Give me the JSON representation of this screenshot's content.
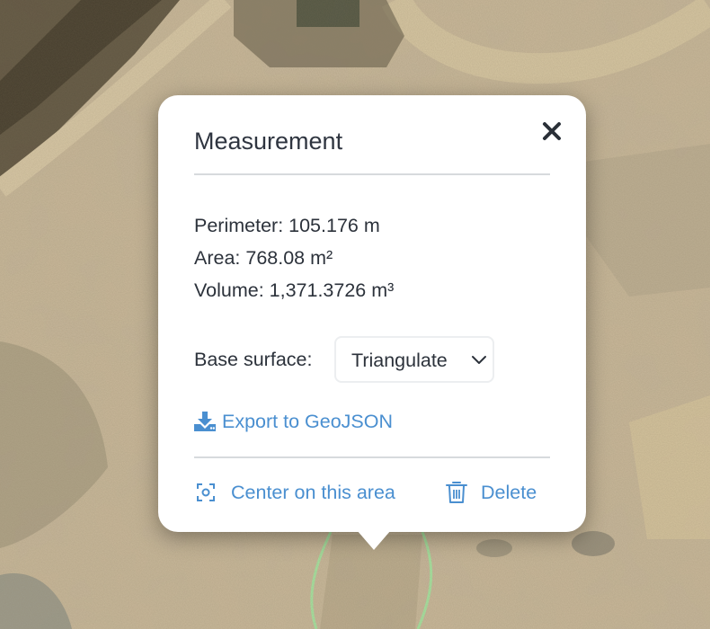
{
  "popup": {
    "title": "Measurement",
    "perimeter": "Perimeter: 105.176 m",
    "area": "Area: 768.08 m²",
    "volume": "Volume: 1,371.3726 m³",
    "base_surface_label": "Base surface:",
    "base_surface_value": "Triangulate",
    "export_label": "Export to GeoJSON",
    "center_label": "Center on this area",
    "delete_label": "Delete"
  },
  "icons": {
    "close": "close-icon",
    "export": "download-icon",
    "center": "focus-icon",
    "delete": "trash-icon",
    "select": "chevron-down-icon"
  },
  "colors": {
    "link": "#4a8fd0",
    "text": "#2c323b",
    "measurement_outline": "#a6e3a0"
  }
}
